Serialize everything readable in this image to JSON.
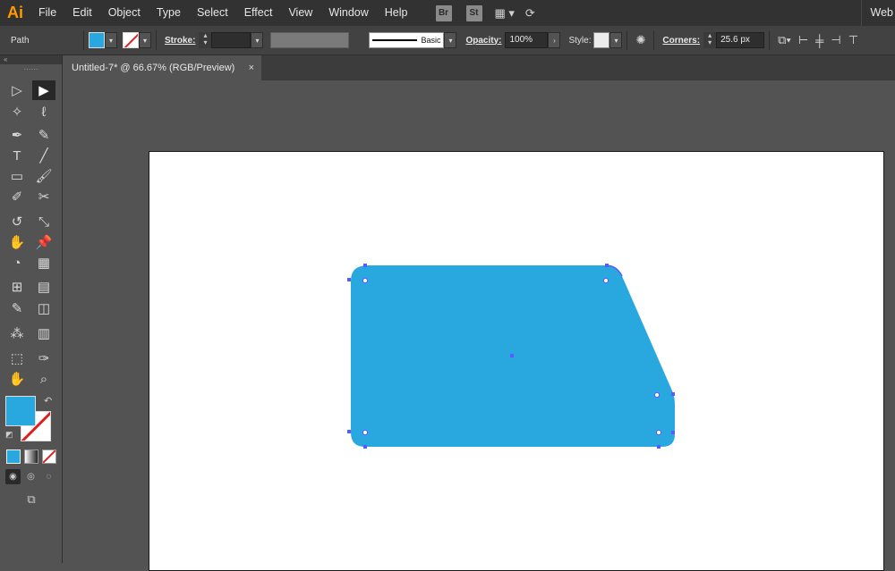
{
  "app": {
    "logo_text": "Ai",
    "workspace_label": "Web"
  },
  "menu": [
    "File",
    "Edit",
    "Object",
    "Type",
    "Select",
    "Effect",
    "View",
    "Window",
    "Help"
  ],
  "menu_badges": {
    "bridge": "Br",
    "stock": "St"
  },
  "control_bar": {
    "selection_type": "Path",
    "stroke_label": "Stroke:",
    "stroke_weight": "",
    "brush_label": "Basic",
    "opacity_label": "Opacity:",
    "opacity_value": "100%",
    "style_label": "Style:",
    "corners_label": "Corners:",
    "corners_value": "25.6 px"
  },
  "document_tab": {
    "title": "Untitled-7* @ 66.67% (RGB/Preview)",
    "close_glyph": "×"
  },
  "colors": {
    "fill": "#29a8e0",
    "stroke": "none",
    "artboard": "#ffffff",
    "ui_dark": "#323232",
    "ui_mid": "#535353",
    "selection": "#5a5aff"
  },
  "tools": [
    {
      "left": "direct-selection-tool",
      "right": "selection-tool",
      "active": "right"
    },
    {
      "left": "magic-wand-tool",
      "right": "lasso-tool"
    },
    {
      "left": "pen-tool",
      "right": "curvature-tool"
    },
    {
      "left": "type-tool",
      "right": "line-segment-tool"
    },
    {
      "left": "rectangle-tool",
      "right": "paintbrush-tool"
    },
    {
      "left": "shaper-tool",
      "right": "scissors-tool"
    },
    {
      "left": "rotate-tool",
      "right": "scale-tool"
    },
    {
      "left": "puppet-warp-tool",
      "right": "pin-tool"
    },
    {
      "left": "shape-builder-tool",
      "right": "perspective-grid-tool"
    },
    {
      "left": "mesh-tool",
      "right": "gradient-tool"
    },
    {
      "left": "eyedropper-tool",
      "right": "blend-tool"
    },
    {
      "left": "symbol-sprayer-tool",
      "right": "column-graph-tool"
    },
    {
      "left": "artboard-tool",
      "right": "slice-tool"
    },
    {
      "left": "hand-tool",
      "right": "zoom-tool"
    }
  ]
}
